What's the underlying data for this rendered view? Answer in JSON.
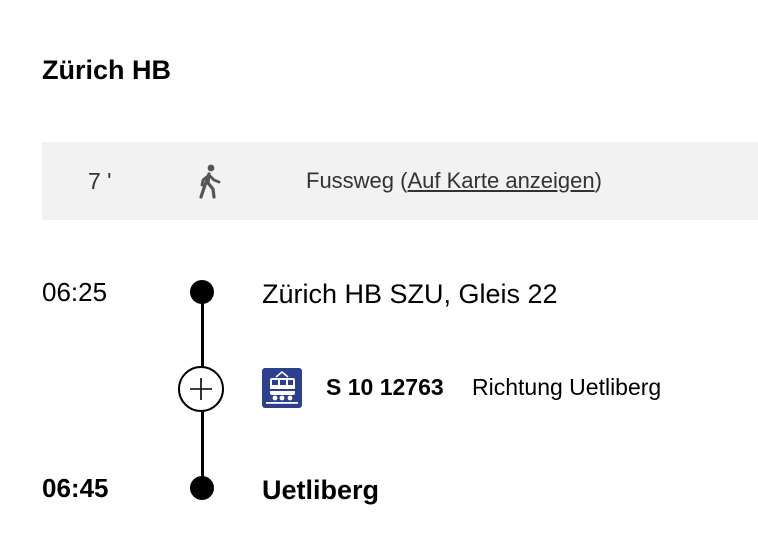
{
  "station": {
    "title": "Zürich HB"
  },
  "walk": {
    "duration": "7 '",
    "icon": "pedestrian-icon",
    "label": "Fussweg",
    "link_open": "(",
    "link_text": "Auf Karte anzeigen",
    "link_close": ")"
  },
  "journey": {
    "departure": {
      "time": "06:25",
      "stop": "Zürich HB SZU, Gleis 22"
    },
    "train": {
      "icon": "train-icon",
      "icon_color": "#2d3f8f",
      "line": "S 10 12763",
      "direction": "Richtung Uetliberg"
    },
    "arrival": {
      "time": "06:45",
      "stop": "Uetliberg"
    },
    "expand_icon": "plus-icon"
  }
}
